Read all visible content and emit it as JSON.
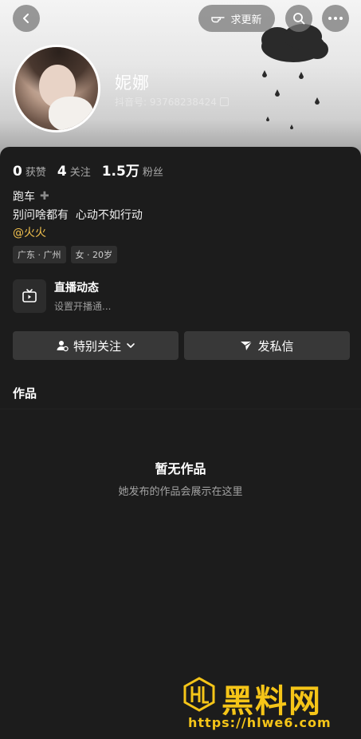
{
  "header": {
    "follow_update_label": "求更新"
  },
  "profile": {
    "nickname": "妮娜",
    "account_id": "抖音号: 93768238424"
  },
  "stats": [
    {
      "num": "0",
      "label": "获赞"
    },
    {
      "num": "4",
      "label": "关注"
    },
    {
      "num": "1.5万",
      "label": "粉丝"
    }
  ],
  "bio": {
    "tag": "跑车",
    "line": "别问啥都有  心动不如行动",
    "mention": "@火火"
  },
  "chips": [
    "广东 · 广州",
    "女 · 20岁"
  ],
  "live": {
    "title": "直播动态",
    "subtitle": "设置开播通..."
  },
  "actions": {
    "special_follow": "特别关注",
    "message": "发私信"
  },
  "works": {
    "title": "作品",
    "empty_title": "暂无作品",
    "empty_subtitle": "她发布的作品会展示在这里"
  },
  "watermark": {
    "brand": "黑料网",
    "url": "https://hlwe6.com"
  },
  "colors": {
    "accent_mention": "#f2c14e",
    "watermark": "#f5c518",
    "background": "#1c1c1c"
  }
}
